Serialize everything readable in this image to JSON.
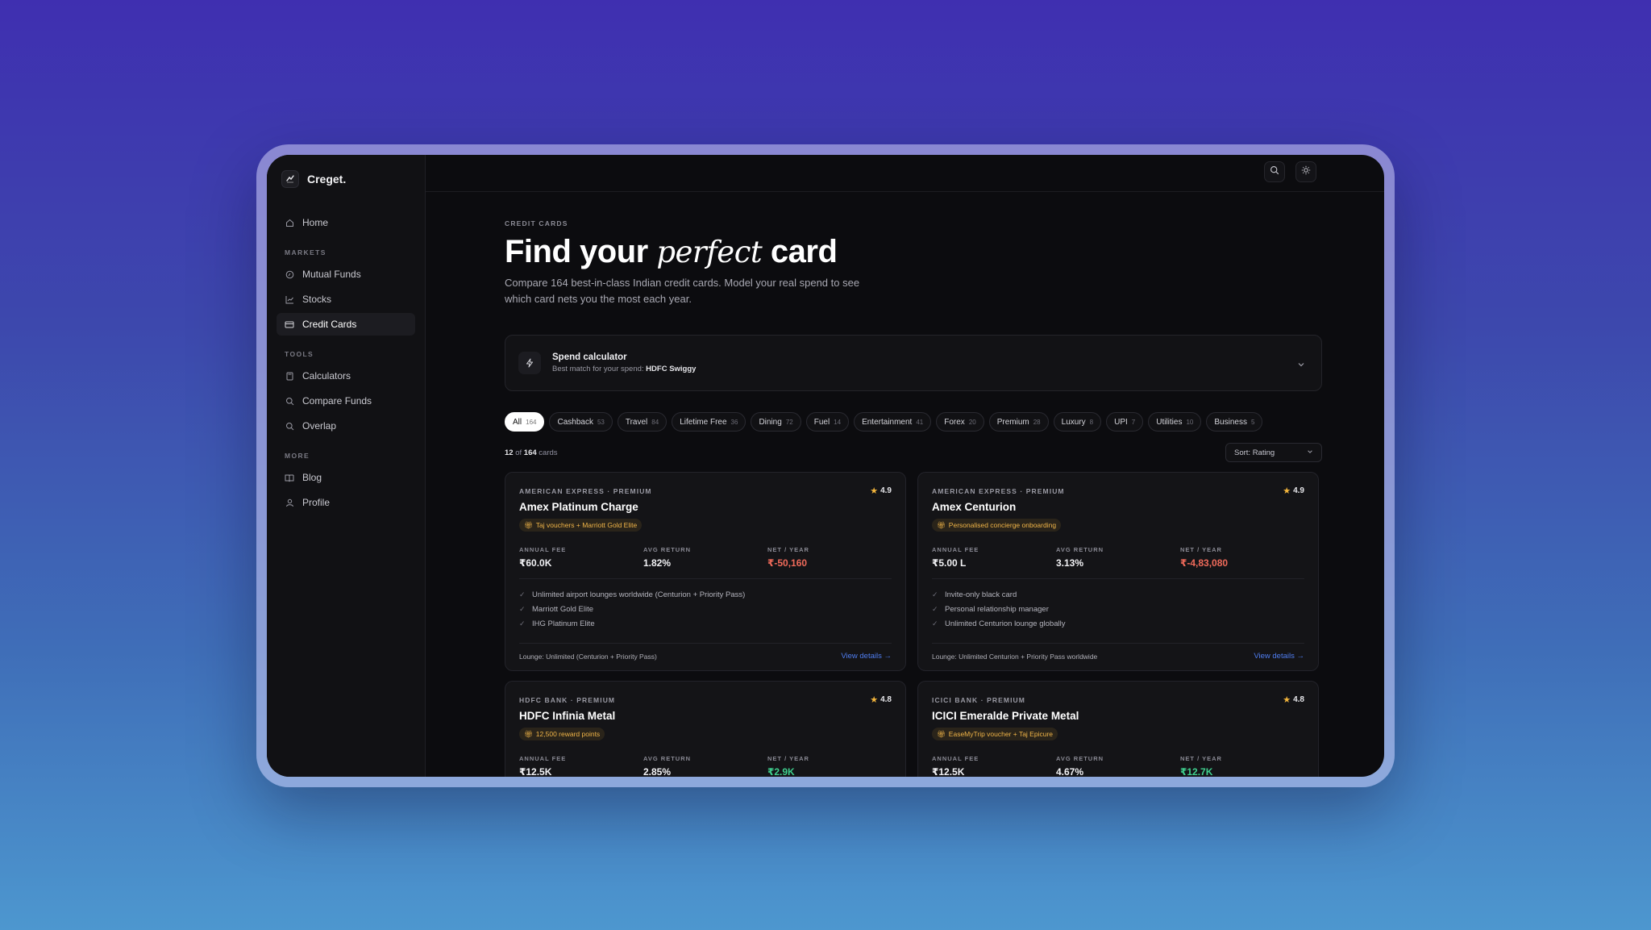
{
  "brand": {
    "name": "Creget."
  },
  "sidebar": {
    "home": "Home",
    "sections": {
      "markets": "MARKETS",
      "tools": "TOOLS",
      "more": "MORE"
    },
    "markets": [
      "Mutual Funds",
      "Stocks",
      "Credit Cards"
    ],
    "tools": [
      "Calculators",
      "Compare Funds",
      "Overlap"
    ],
    "more": [
      "Blog",
      "Profile"
    ],
    "active": "Credit Cards"
  },
  "page": {
    "eyebrow": "CREDIT CARDS",
    "title_a": "Find your",
    "title_italic": "perfect",
    "title_b": "card",
    "subtitle": "Compare 164 best-in-class Indian credit cards. Model your real spend to see which card nets you the most each year."
  },
  "calculator": {
    "title": "Spend calculator",
    "sub_prefix": "Best match for your spend:",
    "best_match": "HDFC Swiggy"
  },
  "filters": [
    {
      "label": "All",
      "count": "164",
      "active": true
    },
    {
      "label": "Cashback",
      "count": "53"
    },
    {
      "label": "Travel",
      "count": "84"
    },
    {
      "label": "Lifetime Free",
      "count": "36"
    },
    {
      "label": "Dining",
      "count": "72"
    },
    {
      "label": "Fuel",
      "count": "14"
    },
    {
      "label": "Entertainment",
      "count": "41"
    },
    {
      "label": "Forex",
      "count": "20"
    },
    {
      "label": "Premium",
      "count": "28"
    },
    {
      "label": "Luxury",
      "count": "8"
    },
    {
      "label": "UPI",
      "count": "7"
    },
    {
      "label": "Utilities",
      "count": "10"
    },
    {
      "label": "Business",
      "count": "5"
    }
  ],
  "results": {
    "shown": "12",
    "of": "of",
    "total": "164",
    "suffix": "cards"
  },
  "sort": {
    "label": "Sort: Rating"
  },
  "stat_labels": {
    "fee": "ANNUAL FEE",
    "ret": "AVG RETURN",
    "net": "NET / YEAR"
  },
  "cards": [
    {
      "issuer": "AMERICAN EXPRESS · PREMIUM",
      "rating": "4.9",
      "name": "Amex Platinum Charge",
      "perk": "Taj vouchers + Marriott Gold Elite",
      "fee": "₹60.0K",
      "ret": "1.82%",
      "net": "₹-50,160",
      "features": [
        "Unlimited airport lounges worldwide (Centurion + Priority Pass)",
        "Marriott Gold Elite",
        "IHG Platinum Elite"
      ],
      "lounge": "Lounge: Unlimited (Centurion + Priority Pass)",
      "link": "View details →"
    },
    {
      "issuer": "AMERICAN EXPRESS · PREMIUM",
      "rating": "4.9",
      "name": "Amex Centurion",
      "perk": "Personalised concierge onboarding",
      "fee": "₹5.00 L",
      "ret": "3.13%",
      "net": "₹-4,83,080",
      "features": [
        "Invite-only black card",
        "Personal relationship manager",
        "Unlimited Centurion lounge globally"
      ],
      "lounge": "Lounge: Unlimited Centurion + Priority Pass worldwide",
      "link": "View details →"
    },
    {
      "issuer": "HDFC BANK · PREMIUM",
      "rating": "4.8",
      "name": "HDFC Infinia Metal",
      "perk": "12,500 reward points",
      "fee": "₹12.5K",
      "ret": "2.85%",
      "net": "₹2.9K"
    },
    {
      "issuer": "ICICI BANK · PREMIUM",
      "rating": "4.8",
      "name": "ICICI Emeralde Private Metal",
      "perk": "EaseMyTrip voucher + Taj Epicure",
      "fee": "₹12.5K",
      "ret": "4.67%",
      "net": "₹12.7K"
    }
  ],
  "colors": {
    "background": "#0c0c0f",
    "accent_link": "#4f7df0",
    "negative": "#ef6a5a",
    "positive": "#3fcf8e",
    "star": "#f6b73c"
  }
}
